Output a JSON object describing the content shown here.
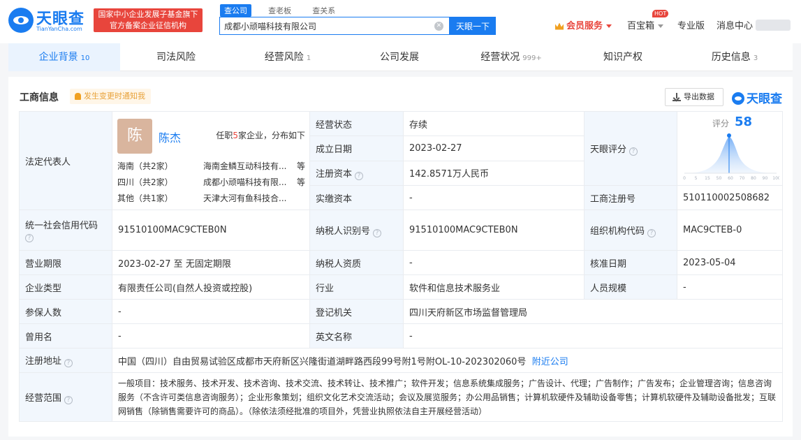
{
  "header": {
    "logo_text": "天眼查",
    "logo_sub": "TianYanCha.com",
    "gov_line1": "国家中小企业发展子基金旗下",
    "gov_line2": "官方备案企业征信机构",
    "search_tabs": [
      "查公司",
      "查老板",
      "查关系"
    ],
    "search_value": "成都小顽喵科技有限公司",
    "search_button": "天眼一下",
    "vip": "会员服务",
    "baobao": "百宝箱",
    "hot": "HOT",
    "pro": "专业版",
    "msg": "消息中心"
  },
  "tabs": [
    {
      "label": "企业背景",
      "count": "10"
    },
    {
      "label": "司法风险",
      "count": ""
    },
    {
      "label": "经营风险",
      "count": "1"
    },
    {
      "label": "公司发展",
      "count": ""
    },
    {
      "label": "经营状况",
      "count": "999+"
    },
    {
      "label": "知识产权",
      "count": ""
    },
    {
      "label": "历史信息",
      "count": "3"
    }
  ],
  "section": {
    "title": "工商信息",
    "notice": "发生变更时通知我",
    "export": "导出数据",
    "brand": "天眼查"
  },
  "legal": {
    "label": "法定代表人",
    "avatar_char": "陈",
    "name": "陈杰",
    "summary_pre": "任职",
    "summary_count": "5",
    "summary_post": "家企业，分布如下",
    "regions": [
      {
        "region": "海南（共2家）",
        "company": "海南金鳞互动科技有...",
        "more": "等"
      },
      {
        "region": "四川（共2家）",
        "company": "成都小顽喵科技有限...",
        "more": "等"
      },
      {
        "region": "其他（共1家）",
        "company": "天津大河有鱼科技合...",
        "more": ""
      }
    ]
  },
  "rows": {
    "status_label": "经营状态",
    "status": "存续",
    "founded_label": "成立日期",
    "founded": "2023-02-27",
    "capital_label": "注册资本",
    "capital": "142.8571万人民币",
    "paid_label": "实缴资本",
    "paid": "-",
    "score_label": "天眼评分",
    "score_word": "评分",
    "score": "58",
    "regno_label": "工商注册号",
    "regno": "510110002508682",
    "credit_label": "统一社会信用代码",
    "credit": "91510100MAC9CTEB0N",
    "taxid_label": "纳税人识别号",
    "taxid": "91510100MAC9CTEB0N",
    "orgcode_label": "组织机构代码",
    "orgcode": "MAC9CTEB-0",
    "term_label": "营业期限",
    "term": "2023-02-27 至 无固定期限",
    "taxq_label": "纳税人资质",
    "taxq": "-",
    "approve_label": "核准日期",
    "approve": "2023-05-04",
    "type_label": "企业类型",
    "type": "有限责任公司(自然人投资或控股)",
    "industry_label": "行业",
    "industry": "软件和信息技术服务业",
    "staff_label": "人员规模",
    "staff": "-",
    "insured_label": "参保人数",
    "insured": "-",
    "authority_label": "登记机关",
    "authority": "四川天府新区市场监督管理局",
    "formername_label": "曾用名",
    "formername": "-",
    "english_label": "英文名称",
    "english": "-",
    "address_label": "注册地址",
    "address": "中国（四川）自由贸易试验区成都市天府新区兴隆街道湖畔路西段99号附1号附OL-10-202302060号",
    "nearby": "附近公司",
    "scope_label": "经营范围",
    "scope": "一般项目：技术服务、技术开发、技术咨询、技术交流、技术转让、技术推广；软件开发；信息系统集成服务；广告设计、代理；广告制作；广告发布；企业管理咨询；信息咨询服务（不含许可类信息咨询服务）；企业形象策划；组织文化艺术交流活动；会议及展览服务；办公用品销售；计算机软硬件及辅助设备零售；计算机软硬件及辅助设备批发；互联网销售（除销售需要许可的商品）。（除依法须经批准的项目外，凭营业执照依法自主开展经营活动）"
  },
  "score_axis": [
    "0",
    "5",
    "15",
    "50",
    "60",
    "70",
    "80",
    "90",
    "100"
  ],
  "colors": {
    "brand": "#1a7cf0",
    "red": "#e8453c",
    "label_bg": "#f2f7fd"
  }
}
